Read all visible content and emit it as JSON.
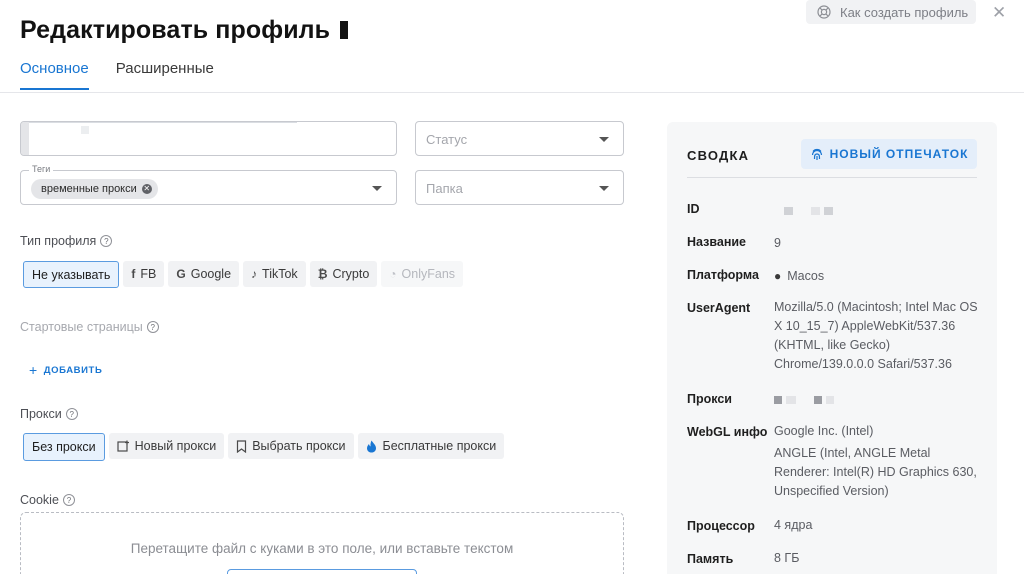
{
  "header": {
    "title": "Редактировать профиль",
    "help_label": "Как создать профиль",
    "close_icon": "close-icon"
  },
  "tabs": [
    {
      "label": "Основное",
      "active": true
    },
    {
      "label": "Расширенные",
      "active": false
    }
  ],
  "form": {
    "status_placeholder": "Статус",
    "tags_label": "Теги",
    "tag_chip": "временные прокси",
    "folder_placeholder": "Папка",
    "profile_type_label": "Тип профиля",
    "profile_types": [
      {
        "label": "Не указывать",
        "icon": "",
        "state": "selected"
      },
      {
        "label": "FB",
        "icon": "facebook-icon",
        "state": "normal"
      },
      {
        "label": "Google",
        "icon": "google-icon",
        "state": "normal"
      },
      {
        "label": "TikTok",
        "icon": "tiktok-icon",
        "state": "normal"
      },
      {
        "label": "Crypto",
        "icon": "bitcoin-icon",
        "state": "normal"
      },
      {
        "label": "OnlyFans",
        "icon": "onlyfans-icon",
        "state": "disabled"
      }
    ],
    "start_pages_label": "Стартовые страницы",
    "add_label": "ДОБАВИТЬ",
    "proxy_label": "Прокси",
    "proxy_options": [
      {
        "label": "Без прокси",
        "icon": "",
        "state": "selected"
      },
      {
        "label": "Новый прокси",
        "icon": "new-proxy-icon",
        "state": "normal"
      },
      {
        "label": "Выбрать прокси",
        "icon": "bookmark-icon",
        "state": "normal"
      },
      {
        "label": "Бесплатные прокси",
        "icon": "flame-icon",
        "state": "normal"
      }
    ],
    "cookie_label": "Cookie",
    "dropzone_text": "Перетащите файл с куками в это поле, или вставьте текстом"
  },
  "summary": {
    "title": "СВОДКА",
    "fingerprint_button": "НОВЫЙ ОТПЕЧАТОК",
    "rows": [
      {
        "label": "ID",
        "value": ""
      },
      {
        "label": "Название",
        "value": "9"
      },
      {
        "label": "Платформа",
        "value": "Macos"
      },
      {
        "label": "UserAgent",
        "value": "Mozilla/5.0 (Macintosh; Intel Mac OS X 10_15_7) AppleWebKit/537.36 (KHTML, like Gecko) Chrome/139.0.0.0 Safari/537.36"
      },
      {
        "label": "Прокси",
        "value": ""
      },
      {
        "label": "WebGL инфо",
        "value": "Google Inc. (Intel)"
      },
      {
        "label": "",
        "value": "ANGLE (Intel, ANGLE Metal Renderer: Intel(R) HD Graphics 630, Unspecified Version)"
      },
      {
        "label": "Процессор",
        "value": "4 ядра"
      },
      {
        "label": "Память",
        "value": "8 ГБ"
      }
    ]
  },
  "colors": {
    "accent": "#1976d2",
    "selected_bg": "#e8f2fd",
    "panel_bg": "#f6f7f8"
  }
}
